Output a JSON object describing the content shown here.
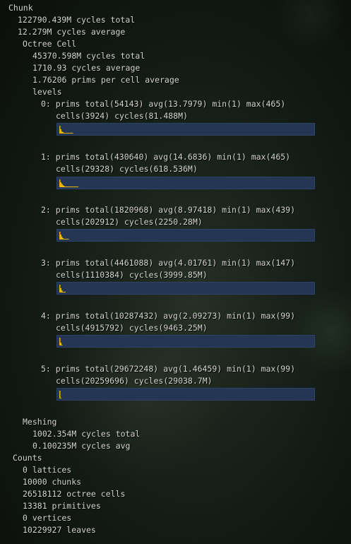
{
  "chunk": {
    "title": "Chunk",
    "cycles_total": "122790.439M cycles total",
    "cycles_average": "12.279M cycles average"
  },
  "octree": {
    "title": "Octree Cell",
    "cycles_total": "45370.598M cycles total",
    "cycles_average": "1710.93 cycles average",
    "prims_per_cell": "1.76206 prims per cell average",
    "levels_title": "levels",
    "levels": [
      {
        "line1": "0: prims total(54143) avg(13.7979) min(1) max(465)",
        "line2": "cells(3924) cycles(81.488M)",
        "histogram": [
          0.95,
          0.5,
          0.28,
          0.16,
          0.1,
          0.07,
          0.05,
          0.04,
          0.03,
          0.02,
          0.02,
          0.01,
          0.01
        ]
      },
      {
        "line1": "1: prims total(430640) avg(14.6836) min(1) max(465)",
        "line2": "cells(29328) cycles(618.536M)",
        "histogram": [
          0.95,
          0.6,
          0.38,
          0.24,
          0.16,
          0.11,
          0.08,
          0.06,
          0.05,
          0.04,
          0.03,
          0.03,
          0.02,
          0.02,
          0.01,
          0.01,
          0.01,
          0.01
        ]
      },
      {
        "line1": "2: prims total(1820968) avg(8.97418) min(1) max(439)",
        "line2": "cells(202912) cycles(2250.28M)",
        "histogram": [
          0.95,
          0.55,
          0.3,
          0.18,
          0.1,
          0.06,
          0.04,
          0.02,
          0.01
        ]
      },
      {
        "line1": "3: prims total(4461088) avg(4.01761) min(1) max(147)",
        "line2": "cells(1110384) cycles(3999.85M)",
        "histogram": [
          0.95,
          0.5,
          0.25,
          0.12,
          0.06,
          0.02
        ]
      },
      {
        "line1": "4: prims total(10287432) avg(2.09273) min(1) max(99)",
        "line2": "cells(4915792) cycles(9463.25M)",
        "histogram": [
          0.95,
          0.3,
          0.08
        ]
      },
      {
        "line1": "5: prims total(29672248) avg(1.46459) min(1) max(99)",
        "line2": "cells(20259696) cycles(29038.7M)",
        "histogram": [
          0.95,
          0.12
        ]
      }
    ]
  },
  "meshing": {
    "title": "Meshing",
    "cycles_total": "1002.354M cycles total",
    "cycles_avg": "0.100235M cycles avg"
  },
  "counts": {
    "title": "Counts",
    "lattices": "0 lattices",
    "chunks": "10000 chunks",
    "octree_cells": "26518112 octree cells",
    "primitives": "13381 primitives",
    "vertices": "0 vertices",
    "leaves": "10229927 leaves"
  },
  "colors": {
    "histogram_bar": "#e8b400",
    "histogram_bg": "#243654"
  }
}
